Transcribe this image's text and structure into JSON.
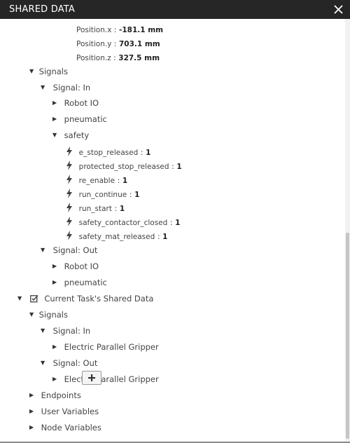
{
  "window": {
    "title": "SHARED DATA"
  },
  "position": {
    "x_label": "Position.x :",
    "x_value": "-181.1",
    "x_unit": "mm",
    "y_label": "Position.y :",
    "y_value": "703.1",
    "y_unit": "mm",
    "z_label": "Position.z :",
    "z_value": "327.5",
    "z_unit": "mm"
  },
  "robot_signals": {
    "label": "Signals",
    "signal_in": {
      "label": "Signal: In",
      "groups": [
        "Robot IO",
        "pneumatic",
        "safety"
      ],
      "safety_items": [
        {
          "name": "e_stop_released",
          "sep": ":",
          "value": "1"
        },
        {
          "name": "protected_stop_released",
          "sep": ":",
          "value": "1"
        },
        {
          "name": "re_enable",
          "sep": ":",
          "value": "1"
        },
        {
          "name": "run_continue",
          "sep": ":",
          "value": "1"
        },
        {
          "name": "run_start",
          "sep": ":",
          "value": "1"
        },
        {
          "name": "safety_contactor_closed",
          "sep": ":",
          "value": "1"
        },
        {
          "name": "safety_mat_released",
          "sep": ":",
          "value": "1"
        }
      ]
    },
    "signal_out": {
      "label": "Signal: Out",
      "groups": [
        "Robot IO",
        "pneumatic"
      ]
    }
  },
  "task": {
    "label": "Current Task's Shared Data",
    "signals_label": "Signals",
    "signal_in_label": "Signal: In",
    "signal_in_item": "Electric Parallel Gripper",
    "signal_out_label": "Signal: Out",
    "signal_out_item": "Electric Parallel Gripper",
    "endpoints_label": "Endpoints",
    "user_variables_label": "User Variables",
    "node_variables_label": "Node Variables"
  }
}
